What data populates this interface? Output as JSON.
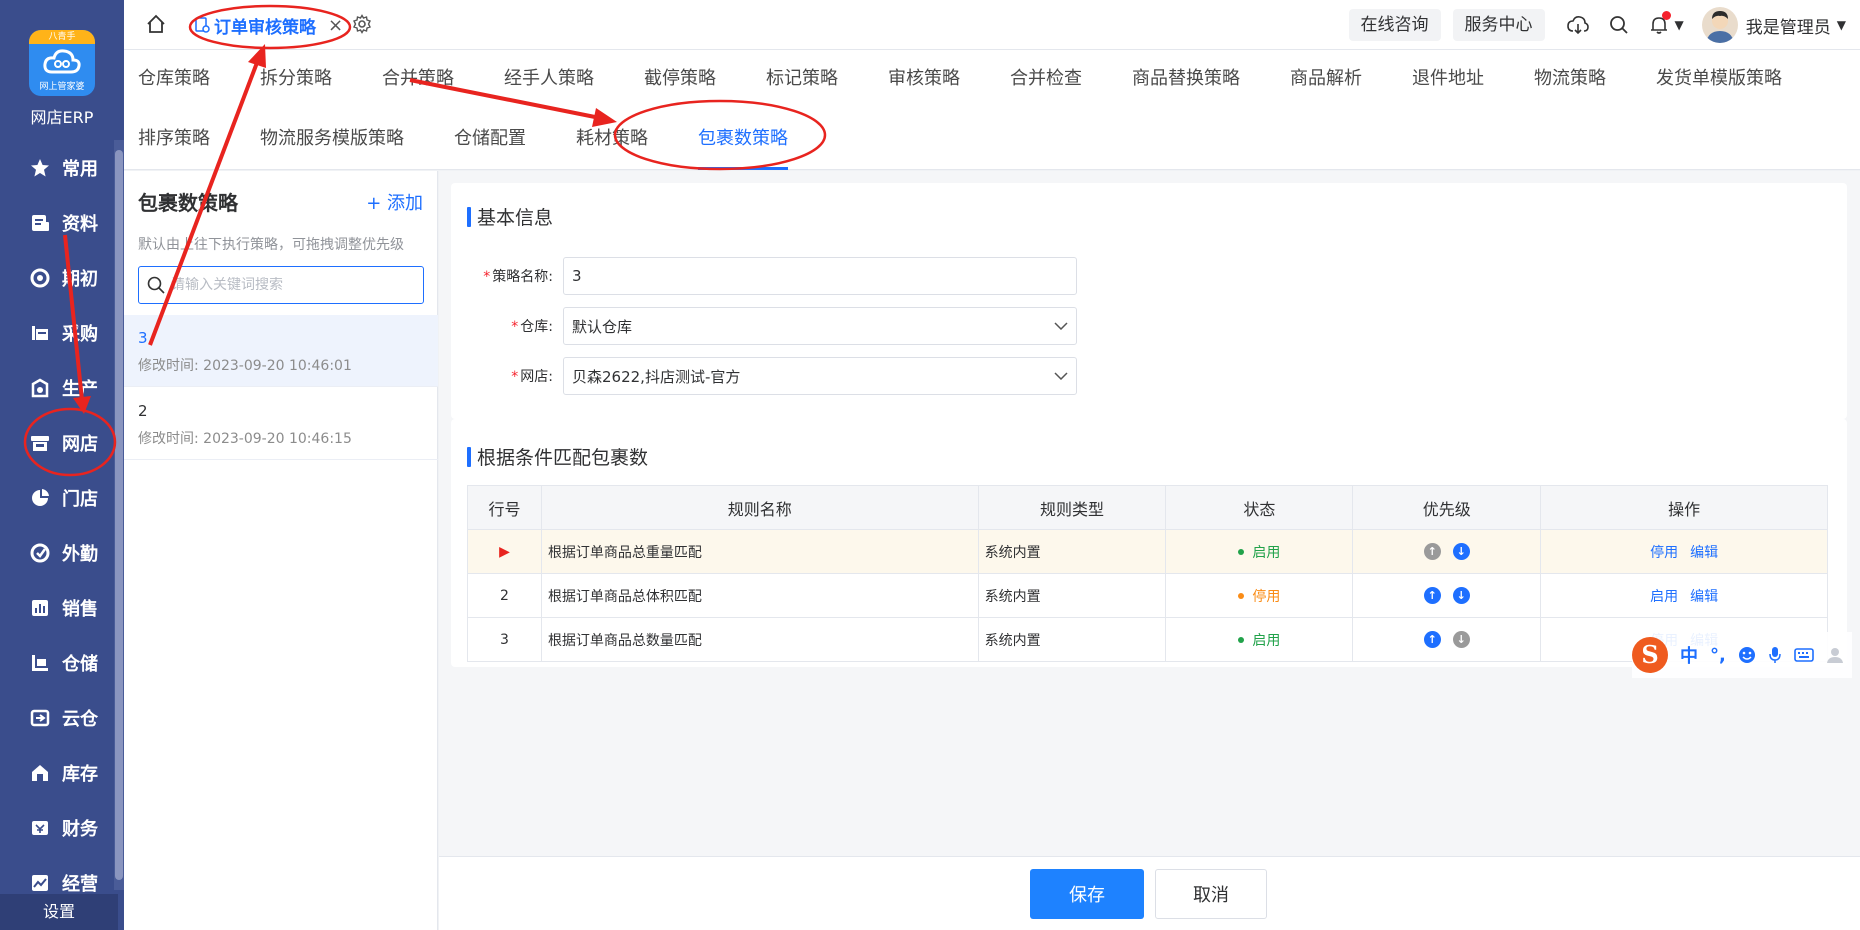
{
  "sidebar": {
    "logo_top": "八青手",
    "logo_sub": "网上管家婆",
    "app_name": "网店ERP",
    "items": [
      {
        "label": "常用",
        "icon": "star-icon"
      },
      {
        "label": "资料",
        "icon": "document-icon"
      },
      {
        "label": "期初",
        "icon": "target-icon"
      },
      {
        "label": "采购",
        "icon": "cart-icon"
      },
      {
        "label": "生产",
        "icon": "production-icon"
      },
      {
        "label": "网店",
        "icon": "store-icon"
      },
      {
        "label": "门店",
        "icon": "pie-icon"
      },
      {
        "label": "外勤",
        "icon": "location-icon"
      },
      {
        "label": "销售",
        "icon": "bar-chart-icon"
      },
      {
        "label": "仓储",
        "icon": "warehouse-icon"
      },
      {
        "label": "云仓",
        "icon": "cloud-warehouse-icon"
      },
      {
        "label": "库存",
        "icon": "inventory-icon"
      },
      {
        "label": "财务",
        "icon": "finance-icon"
      },
      {
        "label": "经营",
        "icon": "trend-icon"
      }
    ],
    "settings": "设置"
  },
  "topbar": {
    "active_tab": "订单审核策略",
    "close_symbol": "×",
    "online_consult": "在线咨询",
    "service_center": "服务中心",
    "user_name": "我是管理员",
    "caret": "▼"
  },
  "strategy_tabs": {
    "row1": [
      "仓库策略",
      "拆分策略",
      "合并策略",
      "经手人策略",
      "截停策略",
      "标记策略",
      "审核策略",
      "合并检查",
      "商品替换策略",
      "商品解析",
      "退件地址",
      "物流策略",
      "发货单模版策略"
    ],
    "row2": [
      "排序策略",
      "物流服务模版策略",
      "仓储配置",
      "耗材策略",
      "包裹数策略"
    ],
    "active": "包裹数策略"
  },
  "left_panel": {
    "title": "包裹数策略",
    "add_label": "+ 添加",
    "hint": "默认由上往下执行策略，可拖拽调整优先级",
    "search_placeholder": "请输入关键词搜索",
    "items": [
      {
        "name": "3",
        "time": "修改时间:  2023-09-20 10:46:01"
      },
      {
        "name": "2",
        "time": "修改时间:  2023-09-20 10:46:15"
      }
    ]
  },
  "basic_info": {
    "title": "基本信息",
    "name_label": "策略名称:",
    "name_value": "3",
    "warehouse_label": "仓库:",
    "warehouse_value": "默认仓库",
    "shop_label": "网店:",
    "shop_value": "贝森2622,抖店测试-官方",
    "required_mark": "*"
  },
  "rules": {
    "title": "根据条件匹配包裹数",
    "columns": [
      "行号",
      "规则名称",
      "规则类型",
      "状态",
      "优先级",
      "操作"
    ],
    "rows": [
      {
        "no": "▶",
        "name": "根据订单商品总重量匹配",
        "type": "系统内置",
        "status": "启用",
        "action": "停用",
        "edit": "编辑"
      },
      {
        "no": "2",
        "name": "根据订单商品总体积匹配",
        "type": "系统内置",
        "status": "停用",
        "action": "启用",
        "edit": "编辑"
      },
      {
        "no": "3",
        "name": "根据订单商品总数量匹配",
        "type": "系统内置",
        "status": "启用",
        "action": "停用",
        "edit": "编辑"
      }
    ],
    "up_arrow": "↑",
    "down_arrow": "↓"
  },
  "footer": {
    "save": "保存",
    "cancel": "取消"
  },
  "ime": {
    "logo": "S",
    "lang": "中",
    "punct": "°,"
  },
  "colors": {
    "accent": "#1e6fff",
    "sidebar": "#3a4d8c",
    "annotation": "#e8241f",
    "enabled": "#21a24a",
    "disabled": "#fa8c16"
  }
}
